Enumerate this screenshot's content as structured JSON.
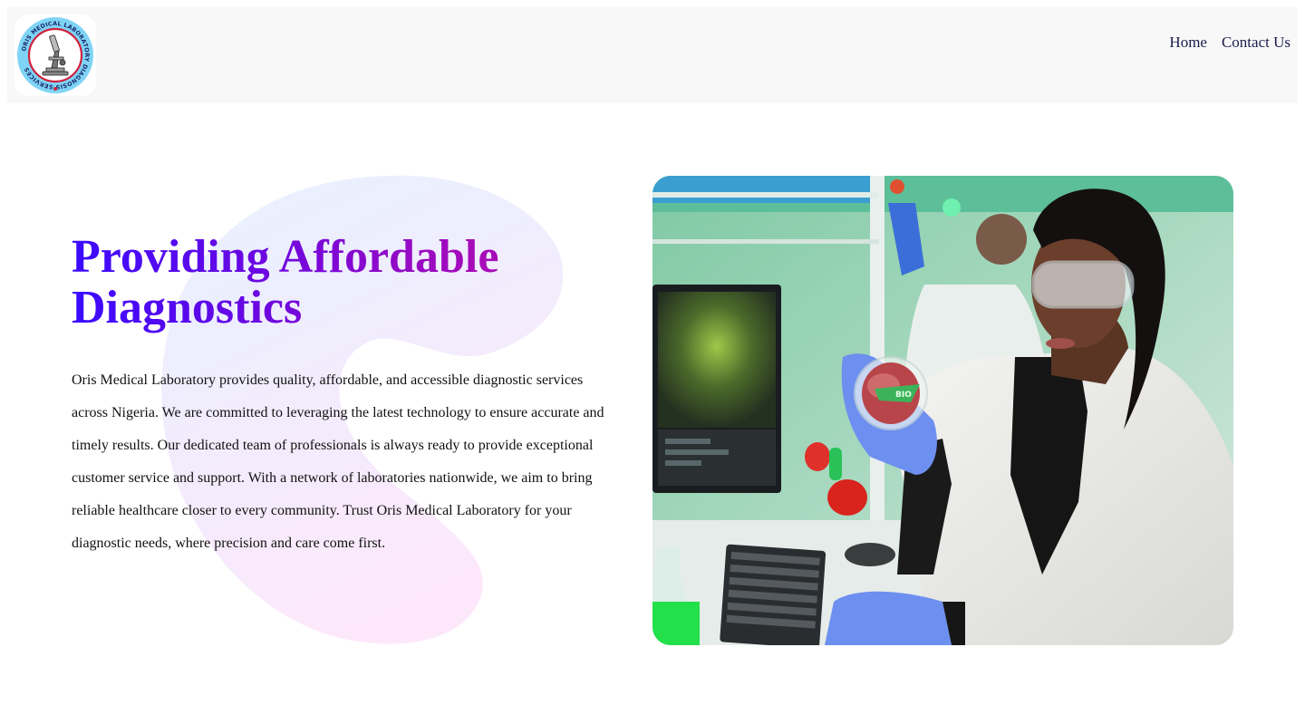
{
  "header": {
    "logo": {
      "icon": "microscope-icon",
      "ring_text": "ORIS MEDICAL LABORATORY DIAGNOSIS SERVICES",
      "ring_color": "#7fd4f5",
      "inner_ring_color": "#d0213c"
    },
    "nav": [
      {
        "label": "Home"
      },
      {
        "label": "Contact Us"
      }
    ]
  },
  "hero": {
    "title": "Providing Affordable Diagnostics",
    "description": "Oris Medical Laboratory provides quality, affordable, and accessible diagnostic services across Nigeria. We are committed to leveraging the latest technology to ensure accurate and timely results. Our dedicated team of professionals is always ready to provide exceptional customer service and support. With a network of laboratories nationwide, we aim to bring reliable healthcare closer to every community. Trust Oris Medical Laboratory for your diagnostic needs, where precision and care come first.",
    "image": {
      "subject": "lab-scientist-photo",
      "petri_label": "BIO"
    }
  },
  "colors": {
    "title_gradient": [
      "#3a0aff",
      "#7a08d8",
      "#a60bb8"
    ],
    "header_bg": "#f8f8f8",
    "nav_text": "#1c1c4e"
  }
}
